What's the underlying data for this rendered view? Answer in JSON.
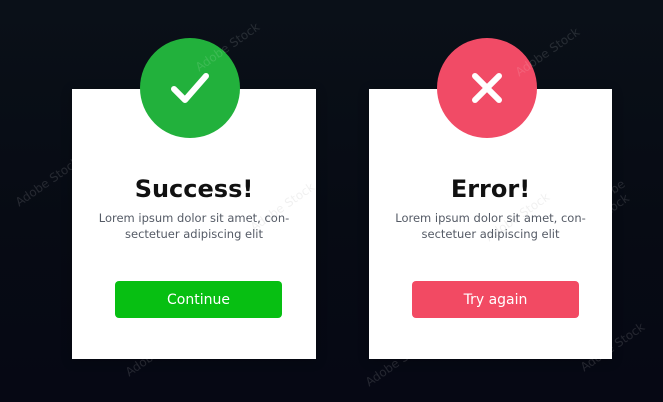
{
  "watermark": "Adobe Stock",
  "colors": {
    "background": "#070b14",
    "card": "#ffffff",
    "success_accent": "#22b13c",
    "success_button": "#07bf12",
    "error_accent": "#f14b66",
    "error_button": "#f24a63"
  },
  "success_dialog": {
    "icon": "checkmark-icon",
    "title": "Success!",
    "line1": "Lorem ipsum dolor sit amet, con-",
    "line2": "sectetuer adipiscing elit",
    "button_label": "Continue"
  },
  "error_dialog": {
    "icon": "close-x-icon",
    "title": "Error!",
    "line1": "Lorem ipsum dolor sit amet, con-",
    "line2": "sectetuer adipiscing elit",
    "button_label": "Try again"
  }
}
